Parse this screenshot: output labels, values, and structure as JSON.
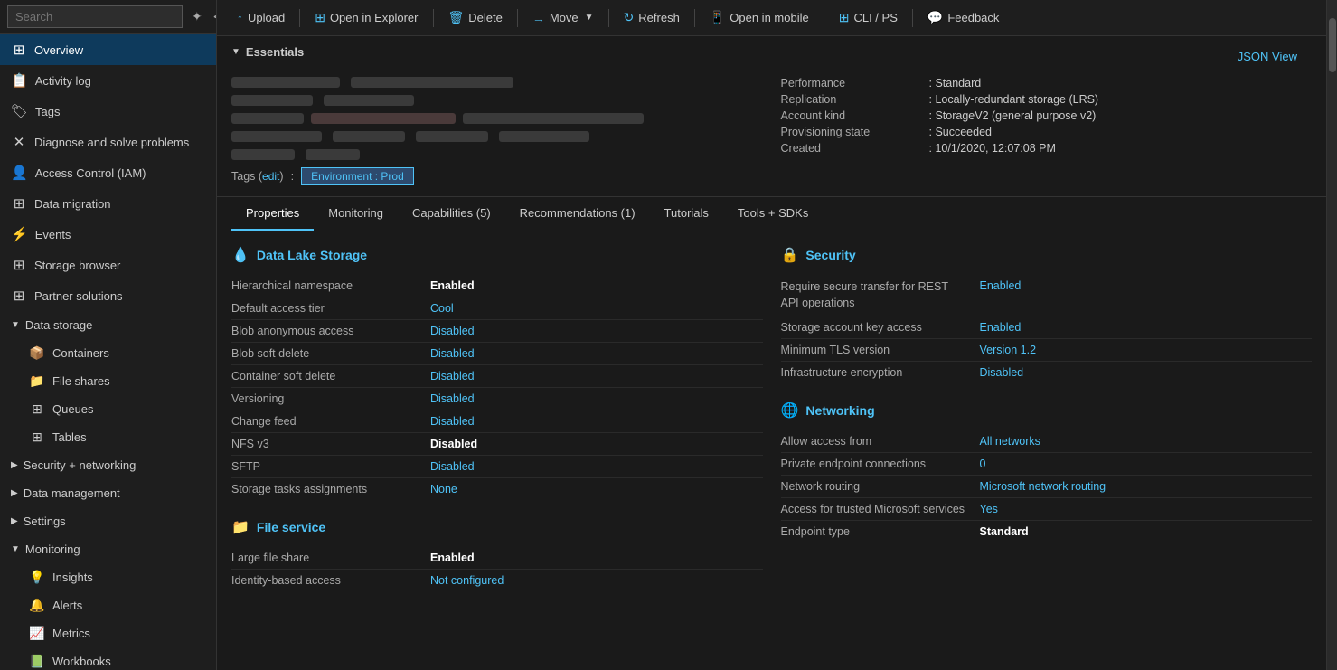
{
  "sidebar": {
    "search_placeholder": "Search",
    "items": [
      {
        "id": "overview",
        "label": "Overview",
        "icon": "⊞",
        "active": true,
        "indent": 0
      },
      {
        "id": "activity-log",
        "label": "Activity log",
        "icon": "📋",
        "active": false,
        "indent": 0
      },
      {
        "id": "tags",
        "label": "Tags",
        "icon": "🏷",
        "active": false,
        "indent": 0
      },
      {
        "id": "diagnose",
        "label": "Diagnose and solve problems",
        "icon": "✕",
        "active": false,
        "indent": 0
      },
      {
        "id": "access-control",
        "label": "Access Control (IAM)",
        "icon": "👤",
        "active": false,
        "indent": 0
      },
      {
        "id": "data-migration",
        "label": "Data migration",
        "icon": "⊞",
        "active": false,
        "indent": 0
      },
      {
        "id": "events",
        "label": "Events",
        "icon": "⚡",
        "active": false,
        "indent": 0
      },
      {
        "id": "storage-browser",
        "label": "Storage browser",
        "icon": "⊞",
        "active": false,
        "indent": 0
      },
      {
        "id": "partner-solutions",
        "label": "Partner solutions",
        "icon": "⊞",
        "active": false,
        "indent": 0
      }
    ],
    "sections": [
      {
        "id": "data-storage",
        "label": "Data storage",
        "expanded": true,
        "items": [
          {
            "id": "containers",
            "label": "Containers",
            "icon": "📦"
          },
          {
            "id": "file-shares",
            "label": "File shares",
            "icon": "📁"
          },
          {
            "id": "queues",
            "label": "Queues",
            "icon": "⊞"
          },
          {
            "id": "tables",
            "label": "Tables",
            "icon": "⊞"
          }
        ]
      },
      {
        "id": "security-networking",
        "label": "Security + networking",
        "expanded": false,
        "items": []
      },
      {
        "id": "data-management",
        "label": "Data management",
        "expanded": false,
        "items": []
      },
      {
        "id": "settings",
        "label": "Settings",
        "expanded": false,
        "items": []
      },
      {
        "id": "monitoring",
        "label": "Monitoring",
        "expanded": true,
        "items": [
          {
            "id": "insights",
            "label": "Insights",
            "icon": "💡"
          },
          {
            "id": "alerts",
            "label": "Alerts",
            "icon": "🔔"
          },
          {
            "id": "metrics",
            "label": "Metrics",
            "icon": "📈"
          },
          {
            "id": "workbooks",
            "label": "Workbooks",
            "icon": "📗"
          }
        ]
      }
    ]
  },
  "toolbar": {
    "buttons": [
      {
        "id": "upload",
        "label": "Upload",
        "icon": "↑"
      },
      {
        "id": "open-explorer",
        "label": "Open in Explorer",
        "icon": "⊞"
      },
      {
        "id": "delete",
        "label": "Delete",
        "icon": "🗑"
      },
      {
        "id": "move",
        "label": "Move",
        "icon": "→",
        "has_dropdown": true
      },
      {
        "id": "refresh",
        "label": "Refresh",
        "icon": "↻"
      },
      {
        "id": "open-mobile",
        "label": "Open in mobile",
        "icon": "📱"
      },
      {
        "id": "cli-ps",
        "label": "CLI / PS",
        "icon": "⊞"
      },
      {
        "id": "feedback",
        "label": "Feedback",
        "icon": "💬"
      }
    ]
  },
  "essentials": {
    "title": "Essentials",
    "json_view_label": "JSON View",
    "props_right": [
      {
        "key": "Performance",
        "value": ": Standard"
      },
      {
        "key": "Replication",
        "value": ": Locally-redundant storage (LRS)"
      },
      {
        "key": "Account kind",
        "value": ": StorageV2 (general purpose v2)"
      },
      {
        "key": "Provisioning state",
        "value": ": Succeeded"
      },
      {
        "key": "Created",
        "value": ": 10/1/2020, 12:07:08 PM"
      }
    ],
    "tags_label": "Tags (edit)",
    "tag_value": "Environment : Prod"
  },
  "tabs": [
    {
      "id": "properties",
      "label": "Properties",
      "active": true
    },
    {
      "id": "monitoring",
      "label": "Monitoring",
      "active": false
    },
    {
      "id": "capabilities",
      "label": "Capabilities (5)",
      "active": false
    },
    {
      "id": "recommendations",
      "label": "Recommendations (1)",
      "active": false
    },
    {
      "id": "tutorials",
      "label": "Tutorials",
      "active": false
    },
    {
      "id": "tools-sdks",
      "label": "Tools + SDKs",
      "active": false
    }
  ],
  "properties": {
    "sections": [
      {
        "id": "data-lake-storage",
        "title": "Data Lake Storage",
        "icon": "💧",
        "rows": [
          {
            "key": "Hierarchical namespace",
            "value": "Enabled",
            "style": "bold"
          },
          {
            "key": "Default access tier",
            "value": "Cool",
            "style": "link"
          },
          {
            "key": "Blob anonymous access",
            "value": "Disabled",
            "style": "disabled"
          },
          {
            "key": "Blob soft delete",
            "value": "Disabled",
            "style": "disabled"
          },
          {
            "key": "Container soft delete",
            "value": "Disabled",
            "style": "disabled"
          },
          {
            "key": "Versioning",
            "value": "Disabled",
            "style": "disabled"
          },
          {
            "key": "Change feed",
            "value": "Disabled",
            "style": "disabled"
          },
          {
            "key": "NFS v3",
            "value": "Disabled",
            "style": "bold"
          },
          {
            "key": "SFTP",
            "value": "Disabled",
            "style": "disabled"
          },
          {
            "key": "Storage tasks assignments",
            "value": "None",
            "style": "link"
          }
        ]
      },
      {
        "id": "file-service",
        "title": "File service",
        "icon": "📁",
        "rows": [
          {
            "key": "Large file share",
            "value": "Enabled",
            "style": "bold"
          },
          {
            "key": "Identity-based access",
            "value": "Not configured",
            "style": "link"
          }
        ]
      }
    ],
    "right_sections": [
      {
        "id": "security",
        "title": "Security",
        "icon": "🔒",
        "rows": [
          {
            "key": "Require secure transfer for REST API operations",
            "value": "Enabled",
            "style": "link"
          },
          {
            "key": "Storage account key access",
            "value": "Enabled",
            "style": "link"
          },
          {
            "key": "Minimum TLS version",
            "value": "Version 1.2",
            "style": "link"
          },
          {
            "key": "Infrastructure encryption",
            "value": "Disabled",
            "style": "disabled"
          }
        ]
      },
      {
        "id": "networking",
        "title": "Networking",
        "icon": "🌐",
        "rows": [
          {
            "key": "Allow access from",
            "value": "All networks",
            "style": "link"
          },
          {
            "key": "Private endpoint connections",
            "value": "0",
            "style": "link"
          },
          {
            "key": "Network routing",
            "value": "Microsoft network routing",
            "style": "link"
          },
          {
            "key": "Access for trusted Microsoft services",
            "value": "Yes",
            "style": "link"
          },
          {
            "key": "Endpoint type",
            "value": "Standard",
            "style": "bold"
          }
        ]
      }
    ]
  }
}
